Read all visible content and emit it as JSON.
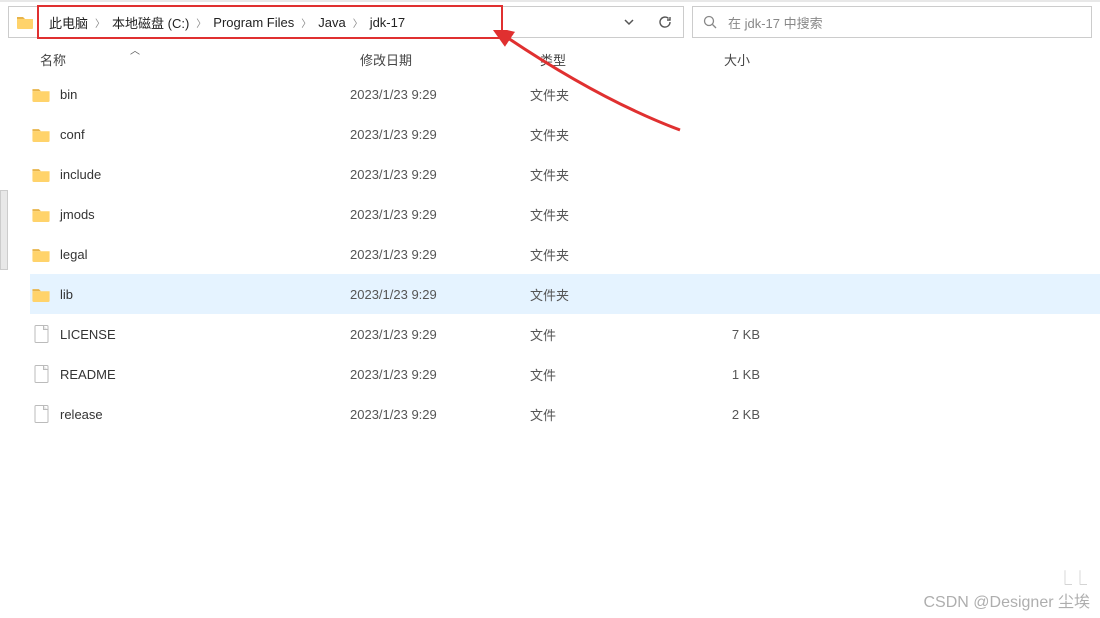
{
  "breadcrumb": {
    "items": [
      "此电脑",
      "本地磁盘 (C:)",
      "Program Files",
      "Java",
      "jdk-17"
    ]
  },
  "search": {
    "placeholder": "在 jdk-17 中搜索"
  },
  "columns": {
    "name": "名称",
    "date": "修改日期",
    "type": "类型",
    "size": "大小"
  },
  "rows": [
    {
      "icon": "folder",
      "name": "bin",
      "date": "2023/1/23 9:29",
      "type": "文件夹",
      "size": "",
      "sel": false
    },
    {
      "icon": "folder",
      "name": "conf",
      "date": "2023/1/23 9:29",
      "type": "文件夹",
      "size": "",
      "sel": false
    },
    {
      "icon": "folder",
      "name": "include",
      "date": "2023/1/23 9:29",
      "type": "文件夹",
      "size": "",
      "sel": false
    },
    {
      "icon": "folder",
      "name": "jmods",
      "date": "2023/1/23 9:29",
      "type": "文件夹",
      "size": "",
      "sel": false
    },
    {
      "icon": "folder",
      "name": "legal",
      "date": "2023/1/23 9:29",
      "type": "文件夹",
      "size": "",
      "sel": false
    },
    {
      "icon": "folder",
      "name": "lib",
      "date": "2023/1/23 9:29",
      "type": "文件夹",
      "size": "",
      "sel": true
    },
    {
      "icon": "file",
      "name": "LICENSE",
      "date": "2023/1/23 9:29",
      "type": "文件",
      "size": "7 KB",
      "sel": false
    },
    {
      "icon": "file",
      "name": "README",
      "date": "2023/1/23 9:29",
      "type": "文件",
      "size": "1 KB",
      "sel": false
    },
    {
      "icon": "file",
      "name": "release",
      "date": "2023/1/23 9:29",
      "type": "文件",
      "size": "2 KB",
      "sel": false
    }
  ],
  "watermark": "CSDN @Designer 尘埃"
}
